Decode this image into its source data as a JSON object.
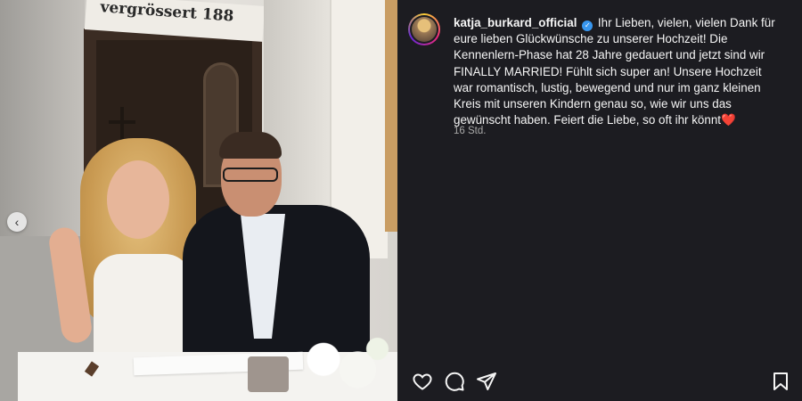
{
  "post": {
    "image_sign_text": "vergrössert 188",
    "carousel_prev_icon": "chevron-left-icon"
  },
  "author": {
    "username": "katja_burkard_official",
    "verified_icon": "verified-badge-icon"
  },
  "caption": {
    "text": "Ihr Lieben, vielen, vielen Dank für eure lieben Glückwünsche zu unserer Hochzeit! Die Kennenlern-Phase hat 28 Jahre gedauert und jetzt sind wir FINALLY MARRIED! Fühlt sich super an! Unsere Hochzeit war romantisch, lustig, bewegend und nur im ganz kleinen Kreis mit unseren Kindern genau so, wie wir uns das gewünscht haben. Feiert die Liebe, so oft ihr könnt",
    "emoji": "❤️"
  },
  "timestamp": "16 Std.",
  "actions": {
    "like_icon": "heart-icon",
    "comment_icon": "comment-icon",
    "share_icon": "send-icon",
    "save_icon": "bookmark-icon"
  },
  "colors": {
    "panel_bg": "#1c1c21",
    "text": "#f5f5f5",
    "muted": "#a8a8a8",
    "verified": "#3897f0"
  }
}
